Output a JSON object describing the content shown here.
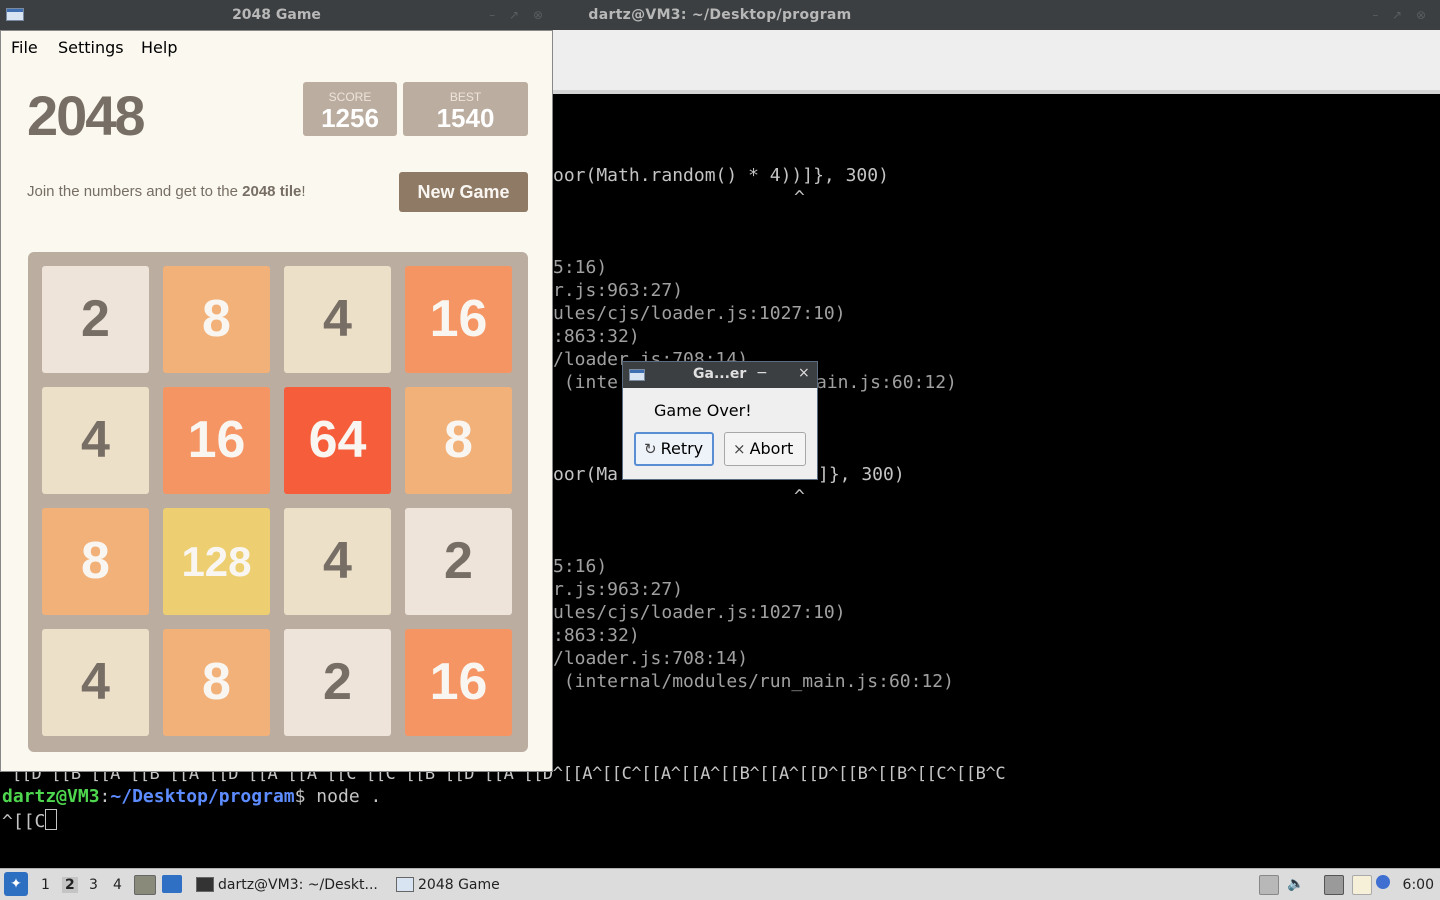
{
  "terminal": {
    "title": "dartz@VM3: ~/Desktop/program",
    "lines": [
      "oor(Math.random() * 4))]}, 300)",
      "^",
      "5:16)",
      "r.js:963:27)",
      "ules/cjs/loader.js:1027:10)",
      ":863:32)",
      "/loader.js:708:14)",
      " (inte",
      "ain.js:60:12)",
      "oor(Ma",
      "]}, 300)",
      "^",
      "5:16)",
      "r.js:963:27)",
      "ules/cjs/loader.js:1027:10)",
      ":863:32)",
      "/loader.js:708:14)",
      " (internal/modules/run_main.js:60:12)",
      "^[[D^[[B^[[A^[[B^[[A^[[D^[[A^[[A^[[C^[[C^[[B^[[D^[[A^[[D^[[A^[[C^[[A^[[A^[[B^[[A^[[D^[[B^[[B^[[C^[[B^C"
    ],
    "prompt_user": "dartz@VM3",
    "prompt_colon": ":",
    "prompt_path": "~/Desktop/program",
    "prompt_symbol": "$",
    "command": " node .",
    "input_line": "^[[C"
  },
  "game": {
    "window_title": "2048 Game",
    "menu": [
      "File",
      "Settings",
      "Help"
    ],
    "logo": "2048",
    "score_label": "SCORE",
    "score": "1256",
    "best_label": "BEST",
    "best": "1540",
    "intro_prefix": "Join the numbers and get to the ",
    "intro_bold": "2048 tile",
    "intro_suffix": "!",
    "new_game_label": "New Game",
    "tiles": [
      [
        "2",
        "8",
        "4",
        "16"
      ],
      [
        "4",
        "16",
        "64",
        "8"
      ],
      [
        "8",
        "128",
        "4",
        "2"
      ],
      [
        "4",
        "8",
        "2",
        "16"
      ]
    ],
    "tile_colors": {
      "2": {
        "bg": "#eee4da",
        "fg": "#776e65"
      },
      "4": {
        "bg": "#ede0c8",
        "fg": "#776e65"
      },
      "8": {
        "bg": "#f2b179",
        "fg": "#f9f6f2"
      },
      "16": {
        "bg": "#f59563",
        "fg": "#f9f6f2"
      },
      "64": {
        "bg": "#f65e3b",
        "fg": "#f9f6f2"
      },
      "128": {
        "bg": "#edcf72",
        "fg": "#f9f6f2"
      }
    }
  },
  "dialog": {
    "title": "Ga...er",
    "minimize": "−",
    "close": "×",
    "message": "Game Over!",
    "retry_label": "Retry",
    "abort_label": "Abort"
  },
  "taskbar": {
    "workspaces": [
      "1",
      "2",
      "3",
      "4"
    ],
    "active_workspace": "2",
    "tasks": [
      "dartz@VM3: ~/Deskt...",
      "2048 Game"
    ],
    "clock": "6:00"
  }
}
